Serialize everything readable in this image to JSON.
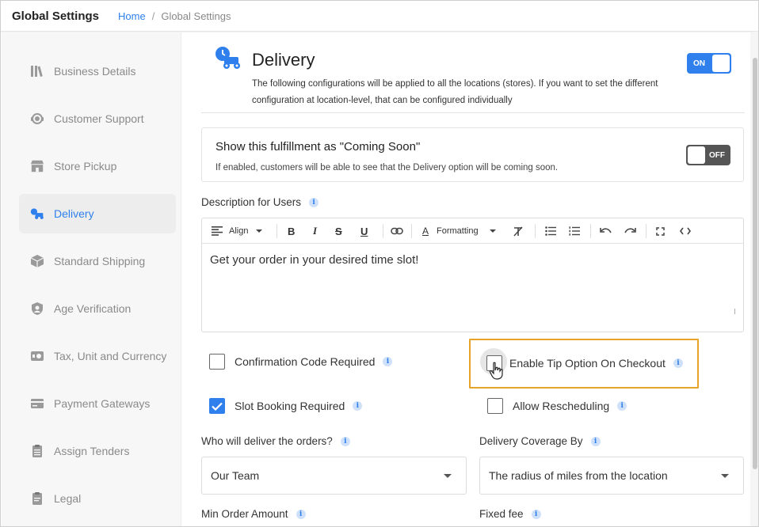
{
  "header": {
    "title": "Global Settings",
    "breadcrumb": {
      "home": "Home",
      "separator": "/",
      "current": "Global Settings"
    }
  },
  "sidebar": {
    "items": [
      {
        "label": "Business Details",
        "icon": "books-icon"
      },
      {
        "label": "Customer Support",
        "icon": "support-agent-icon"
      },
      {
        "label": "Store Pickup",
        "icon": "store-icon"
      },
      {
        "label": "Delivery",
        "icon": "delivery-scooter-icon",
        "active": true
      },
      {
        "label": "Standard Shipping",
        "icon": "package-icon"
      },
      {
        "label": "Age Verification",
        "icon": "shield-user-icon"
      },
      {
        "label": "Tax, Unit and Currency",
        "icon": "money-icon"
      },
      {
        "label": "Payment Gateways",
        "icon": "card-icon"
      },
      {
        "label": "Assign Tenders",
        "icon": "clipboard-icon"
      },
      {
        "label": "Legal",
        "icon": "document-icon"
      }
    ]
  },
  "main": {
    "title": "Delivery",
    "description": "The following configurations will be applied to all the locations (stores). If you want to set the different configuration at location-level, that can be configured individually",
    "enabled_toggle": {
      "label": "ON",
      "state": true
    },
    "coming_soon": {
      "title": "Show this fulfillment as \"Coming Soon\"",
      "description": "If enabled, customers will be able to see that the Delivery option will be coming soon.",
      "toggle_label": "OFF",
      "state": false
    },
    "description_for_users": {
      "label": "Description for Users",
      "toolbar": {
        "align": "Align",
        "formatting": "Formatting"
      },
      "content": "Get your order in your desired time slot!"
    },
    "checkboxes": {
      "confirmation_code": {
        "label": "Confirmation Code Required",
        "checked": false
      },
      "enable_tip": {
        "label": "Enable Tip Option On Checkout",
        "checked": false
      },
      "slot_booking": {
        "label": "Slot Booking Required",
        "checked": true
      },
      "allow_rescheduling": {
        "label": "Allow Rescheduling",
        "checked": false
      }
    },
    "who_delivers": {
      "label": "Who will deliver the orders?",
      "value": "Our Team"
    },
    "coverage": {
      "label": "Delivery Coverage By",
      "value": "The radius of miles from the location"
    },
    "min_order": {
      "label": "Min Order Amount"
    },
    "fixed_fee": {
      "label": "Fixed fee"
    },
    "info_glyph": "i"
  },
  "colors": {
    "accent": "#2f80ed",
    "highlight": "#e8a32a",
    "toggle_off": "#555555"
  }
}
